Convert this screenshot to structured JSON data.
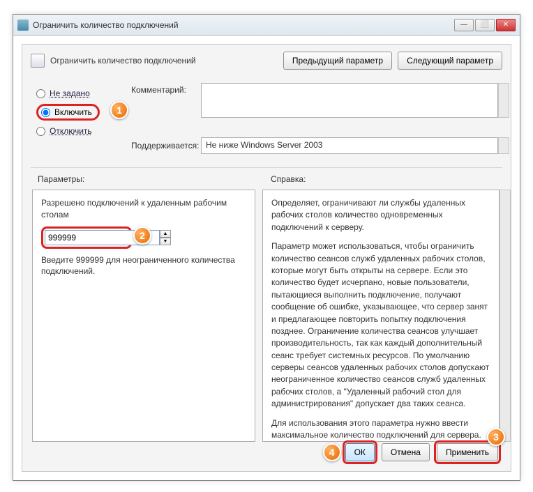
{
  "window": {
    "title": "Ограничить количество подключений",
    "min": "—",
    "max": "⬜",
    "close": "✕"
  },
  "header": {
    "title": "Ограничить количество подключений",
    "prev": "Предыдущий параметр",
    "next": "Следующий параметр"
  },
  "radios": {
    "not_set": "Не задано",
    "enable": "Включить",
    "disable": "Отключить"
  },
  "labels": {
    "comment": "Комментарий:",
    "supported": "Поддерживается:",
    "supported_value": "Не ниже Windows Server 2003",
    "params": "Параметры:",
    "help": "Справка:"
  },
  "params": {
    "prompt": "Разрешено подключений к удаленным рабочим столам",
    "value": "999999",
    "hint": "Введите 999999 для неограниченного количества подключений."
  },
  "help": {
    "p1": "Определяет, ограничивают ли службы удаленных рабочих столов количество одновременных подключений к серверу.",
    "p2": "Параметр может использоваться, чтобы ограничить количество сеансов служб удаленных рабочих столов, которые могут быть открыты на сервере. Если это количество будет исчерпано, новые пользователи, пытающиеся выполнить подключение, получают сообщение об ошибке, указывающее, что сервер занят и предлагающее повторить попытку подключения позднее. Ограничение количества сеансов улучшает производительность, так как каждый дополнительный сеанс требует системных ресурсов. По умолчанию серверы сеансов удаленных рабочих столов допускают неограниченное количество сеансов служб удаленных рабочих столов, а \"Удаленный рабочий стол для администрирования\" допускает два таких сеанса.",
    "p3": "Для использования этого параметра нужно ввести максимальное количество подключений для сервера. Чтобы"
  },
  "buttons": {
    "ok": "ОК",
    "cancel": "Отмена",
    "apply": "Применить"
  },
  "callouts": {
    "c1": "1",
    "c2": "2",
    "c3": "3",
    "c4": "4"
  }
}
